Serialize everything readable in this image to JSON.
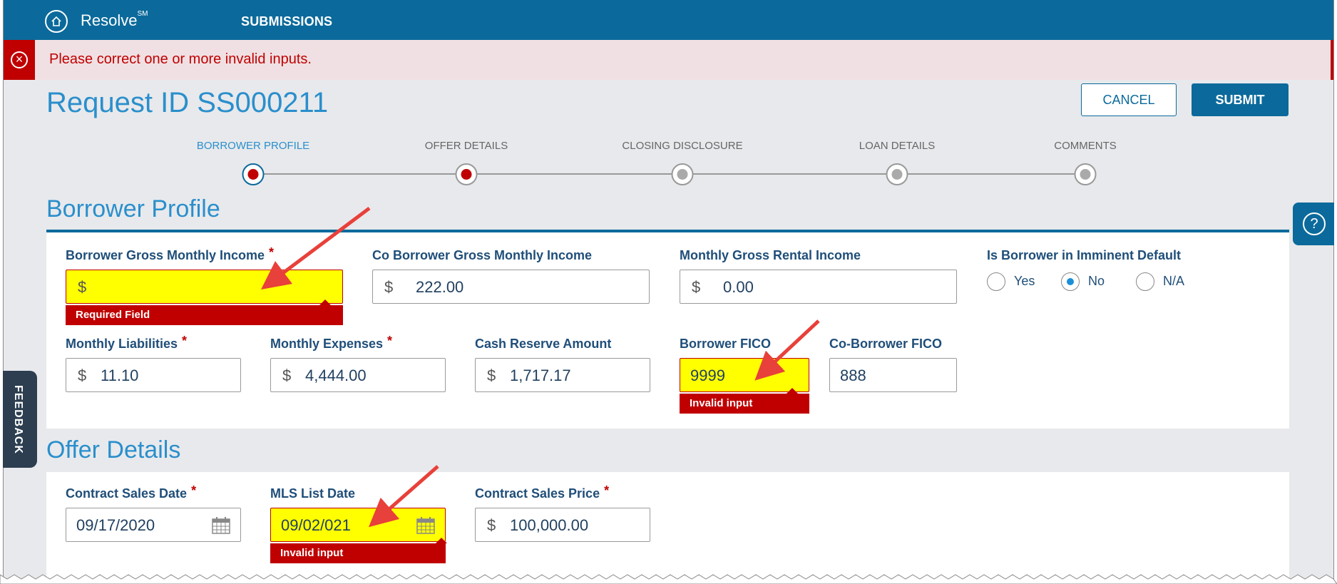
{
  "header": {
    "brand": "Resolve",
    "brand_mark": "SM",
    "nav_submissions": "SUBMISSIONS"
  },
  "alert": {
    "message": "Please correct one or more invalid inputs."
  },
  "page": {
    "title": "Request ID SS000211",
    "cancel_label": "CANCEL",
    "submit_label": "SUBMIT"
  },
  "stepper": {
    "steps": [
      {
        "label": "BORROWER PROFILE",
        "state": "error-active"
      },
      {
        "label": "OFFER DETAILS",
        "state": "error"
      },
      {
        "label": "CLOSING DISCLOSURE",
        "state": "pending"
      },
      {
        "label": "LOAN DETAILS",
        "state": "pending"
      },
      {
        "label": "COMMENTS",
        "state": "pending"
      }
    ]
  },
  "borrower_profile": {
    "title": "Borrower Profile",
    "gross_income": {
      "label": "Borrower Gross Monthly Income",
      "required": "*",
      "currency": "$",
      "value": "",
      "error": "Required Field"
    },
    "co_gross_income": {
      "label": "Co Borrower Gross Monthly Income",
      "currency": "$",
      "value": "222.00"
    },
    "rental_income": {
      "label": "Monthly Gross Rental Income",
      "currency": "$",
      "value": "0.00"
    },
    "imminent_default": {
      "label": "Is Borrower in Imminent Default",
      "options": [
        "Yes",
        "No",
        "N/A"
      ],
      "selected": "No"
    },
    "liabilities": {
      "label": "Monthly Liabilities",
      "required": "*",
      "currency": "$",
      "value": "11.10"
    },
    "expenses": {
      "label": "Monthly Expenses",
      "required": "*",
      "currency": "$",
      "value": "4,444.00"
    },
    "cash_reserve": {
      "label": "Cash Reserve Amount",
      "currency": "$",
      "value": "1,717.17"
    },
    "borrower_fico": {
      "label": "Borrower FICO",
      "value": "9999",
      "error": "Invalid input"
    },
    "co_borrower_fico": {
      "label": "Co-Borrower FICO",
      "value": "888"
    }
  },
  "offer_details": {
    "title": "Offer Details",
    "contract_sales_date": {
      "label": "Contract Sales Date",
      "required": "*",
      "value": "09/17/2020"
    },
    "mls_list_date": {
      "label": "MLS List Date",
      "value": "09/02/021",
      "error": "Invalid input"
    },
    "contract_sales_price": {
      "label": "Contract Sales Price",
      "required": "*",
      "currency": "$",
      "value": "100,000.00"
    }
  },
  "side": {
    "feedback_label": "FEEDBACK"
  },
  "colors": {
    "header": "#0b6a9b",
    "accent": "#2a8fcc",
    "error": "#c00000",
    "invalid_fill": "#ffff00",
    "arrow": "#e8403a"
  }
}
